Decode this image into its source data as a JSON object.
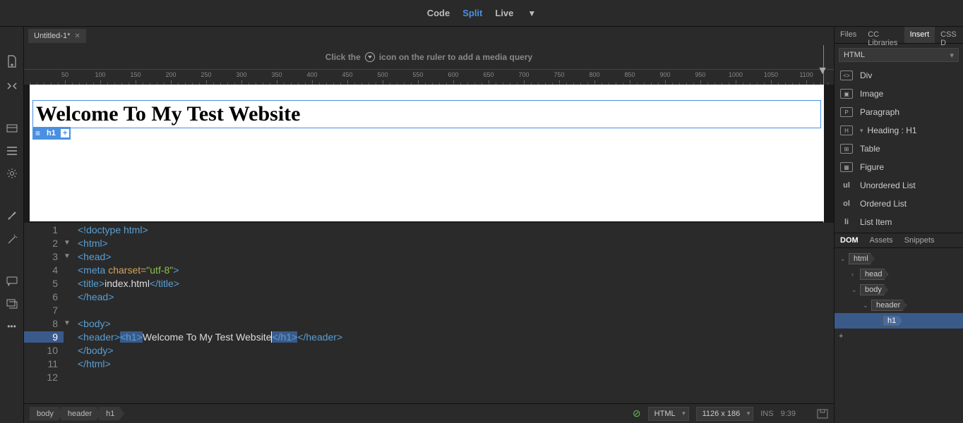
{
  "view_tabs": {
    "code": "Code",
    "split": "Split",
    "live": "Live"
  },
  "file_tab": {
    "name": "Untitled-1*"
  },
  "hint": {
    "before": "Click the",
    "after": "icon on the ruler to add a media query"
  },
  "ruler_ticks": [
    50,
    100,
    150,
    200,
    250,
    300,
    350,
    400,
    450,
    500,
    550,
    600,
    650,
    700,
    750,
    800,
    850,
    900,
    950,
    1000,
    1050,
    1100
  ],
  "preview": {
    "heading": "Welcome To My Test Website",
    "badge_tag": "h1"
  },
  "code": {
    "lines": [
      {
        "n": 1,
        "fold": "",
        "html": "<span class='tag'>&lt;!doctype html&gt;</span>"
      },
      {
        "n": 2,
        "fold": "▼",
        "html": "<span class='tag'>&lt;html&gt;</span>"
      },
      {
        "n": 3,
        "fold": "▼",
        "html": "<span class='tag'>&lt;head&gt;</span>"
      },
      {
        "n": 4,
        "fold": "",
        "html": "<span class='tag'>&lt;meta</span> <span class='attr'>charset=</span><span class='str'>\"utf-8\"</span><span class='tag'>&gt;</span>"
      },
      {
        "n": 5,
        "fold": "",
        "html": "<span class='tag'>&lt;title&gt;</span><span class='txt'>index.html</span><span class='tag'>&lt;/title&gt;</span>"
      },
      {
        "n": 6,
        "fold": "",
        "html": "<span class='tag'>&lt;/head&gt;</span>"
      },
      {
        "n": 7,
        "fold": "",
        "html": ""
      },
      {
        "n": 8,
        "fold": "▼",
        "html": "<span class='tag'>&lt;body&gt;</span>"
      },
      {
        "n": 9,
        "fold": "",
        "hl": true,
        "html": "<span class='tag'>&lt;header&gt;</span><span class='tag sel'>&lt;h1&gt;</span><span class='txt'>Welcome To My Test Website</span><span class='cursor'></span><span class='tag sel'>&lt;/h1&gt;</span><span class='tag'>&lt;/header&gt;</span>"
      },
      {
        "n": 10,
        "fold": "",
        "html": "<span class='tag'>&lt;/body&gt;</span>"
      },
      {
        "n": 11,
        "fold": "",
        "html": "<span class='tag'>&lt;/html&gt;</span>"
      },
      {
        "n": 12,
        "fold": "",
        "html": ""
      }
    ]
  },
  "breadcrumb": [
    "body",
    "header",
    "h1"
  ],
  "status": {
    "lang": "HTML",
    "dims": "1126 x 186",
    "ins": "INS",
    "time": "9:39"
  },
  "panel": {
    "tabs": [
      "Files",
      "CC Libraries",
      "Insert",
      "CSS D"
    ],
    "active_tab": "Insert",
    "category": "HTML",
    "items": [
      {
        "icon": "<>",
        "label": "Div"
      },
      {
        "icon": "▣",
        "label": "Image"
      },
      {
        "icon": "P",
        "label": "Paragraph"
      },
      {
        "icon": "H",
        "label": "Heading : H1",
        "expandable": true
      },
      {
        "icon": "⊞",
        "label": "Table"
      },
      {
        "icon": "▦",
        "label": "Figure"
      },
      {
        "icon": "ul",
        "label": "Unordered List",
        "txt": true
      },
      {
        "icon": "ol",
        "label": "Ordered List",
        "txt": true
      },
      {
        "icon": "li",
        "label": "List Item",
        "txt": true
      }
    ],
    "tabs2": [
      "DOM",
      "Assets",
      "Snippets"
    ],
    "active_tab2": "DOM",
    "dom": [
      {
        "indent": 0,
        "chev": "⌄",
        "tag": "html"
      },
      {
        "indent": 1,
        "chev": "›",
        "tag": "head"
      },
      {
        "indent": 1,
        "chev": "⌄",
        "tag": "body"
      },
      {
        "indent": 2,
        "chev": "⌄",
        "tag": "header"
      },
      {
        "indent": 3,
        "chev": "",
        "tag": "h1",
        "sel": true
      }
    ]
  }
}
